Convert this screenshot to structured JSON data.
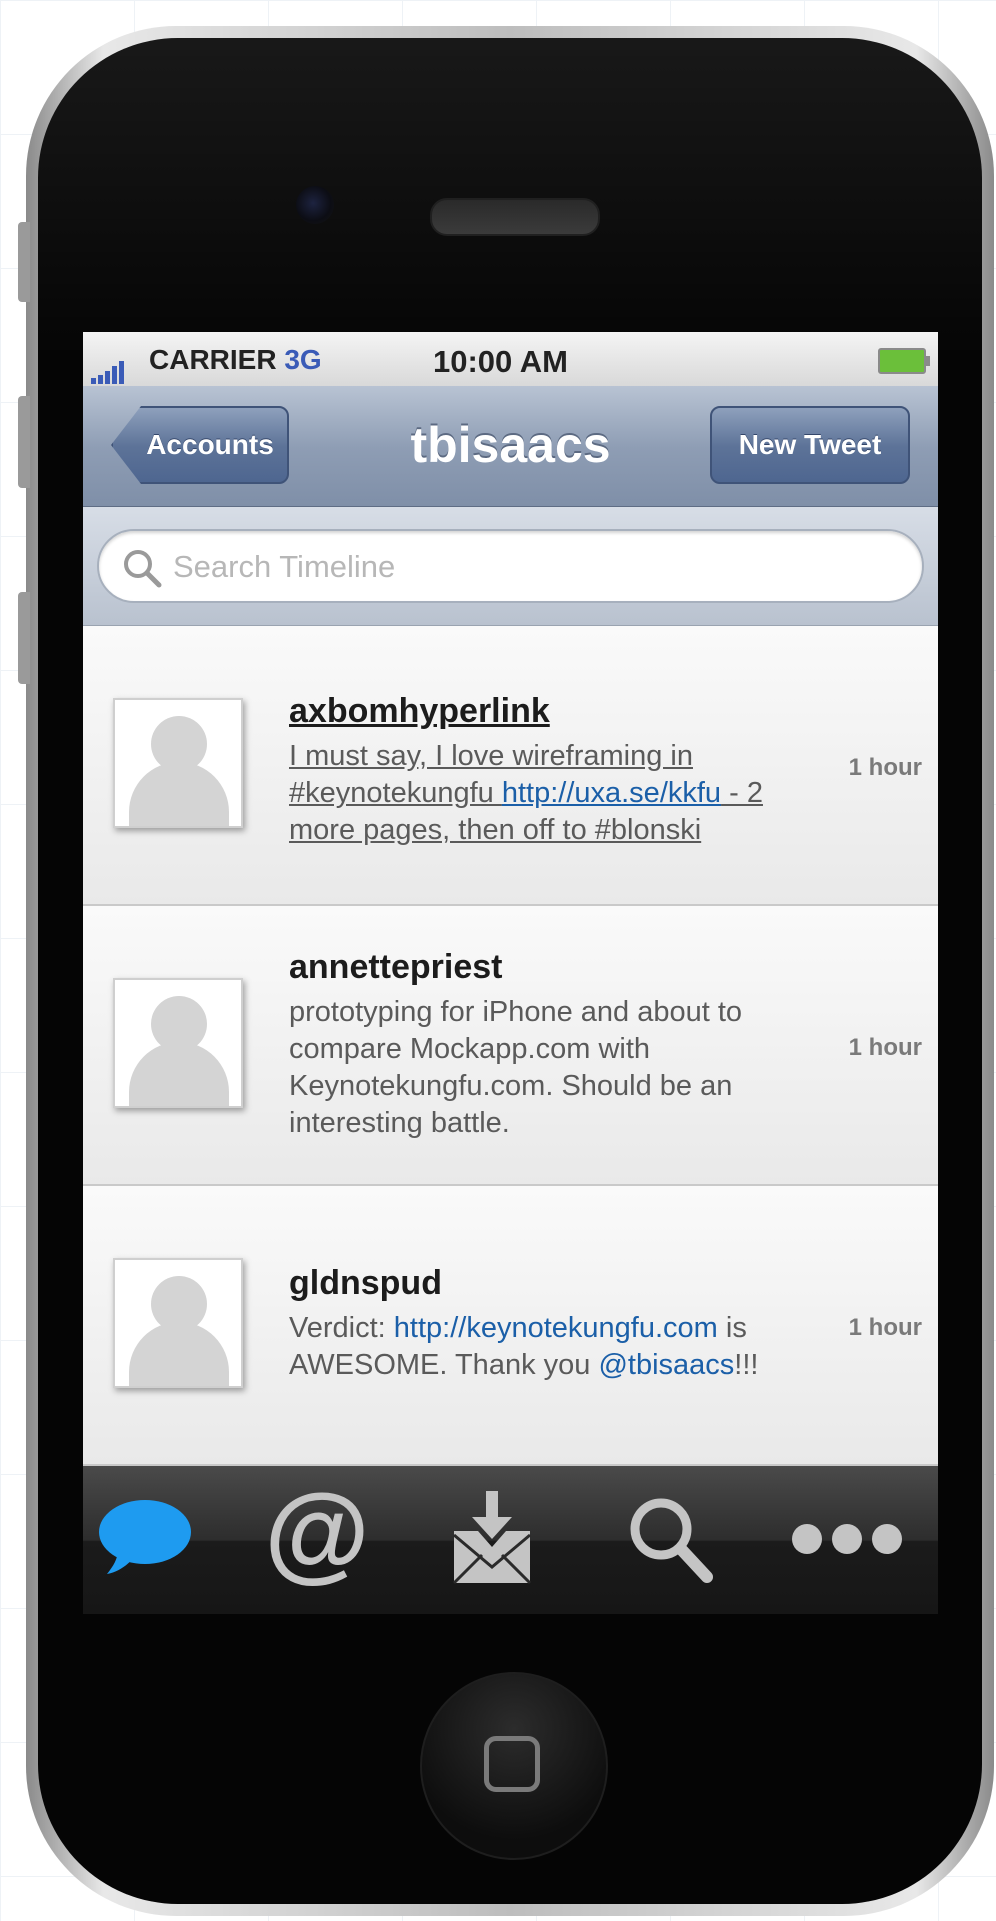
{
  "status_bar": {
    "carrier": "CARRIER",
    "network": "3G",
    "time": "10:00 AM"
  },
  "nav": {
    "back_label": "Accounts",
    "title": "tbisaacs",
    "action_label": "New Tweet"
  },
  "search": {
    "placeholder": "Search Timeline"
  },
  "timeline": [
    {
      "username": "axbomhyperlink",
      "text_before": "I must say, I love wireframing in #keynotekungfu ",
      "link": "http://uxa.se/kkfu",
      "text_after": " - 2 more pages, then off to #blonski",
      "time": "1 hour"
    },
    {
      "username": "annettepriest",
      "text": "prototyping for iPhone and about to compare Mockapp.com with Keynotekungfu.com. Should be an interesting battle.",
      "time": "1 hour"
    },
    {
      "username": "gldnspud",
      "text_before": "Verdict: ",
      "link": "http://keynotekungfu.com",
      "text_middle": " is AWESOME. Thank you ",
      "mention": "@tbisaacs",
      "text_after": "!!!",
      "time": "1 hour"
    }
  ],
  "tab_bar": {
    "tabs": [
      {
        "icon": "speech-bubble-icon",
        "active": true
      },
      {
        "icon": "at-sign-icon",
        "active": false
      },
      {
        "icon": "envelope-download-icon",
        "active": false
      },
      {
        "icon": "magnifier-icon",
        "active": false
      },
      {
        "icon": "more-dots-icon",
        "active": false
      }
    ]
  },
  "colors": {
    "link": "#1b5fa8",
    "network": "#3a5bb7",
    "active_tab": "#1e9bf0",
    "battery": "#6bbf3a"
  }
}
